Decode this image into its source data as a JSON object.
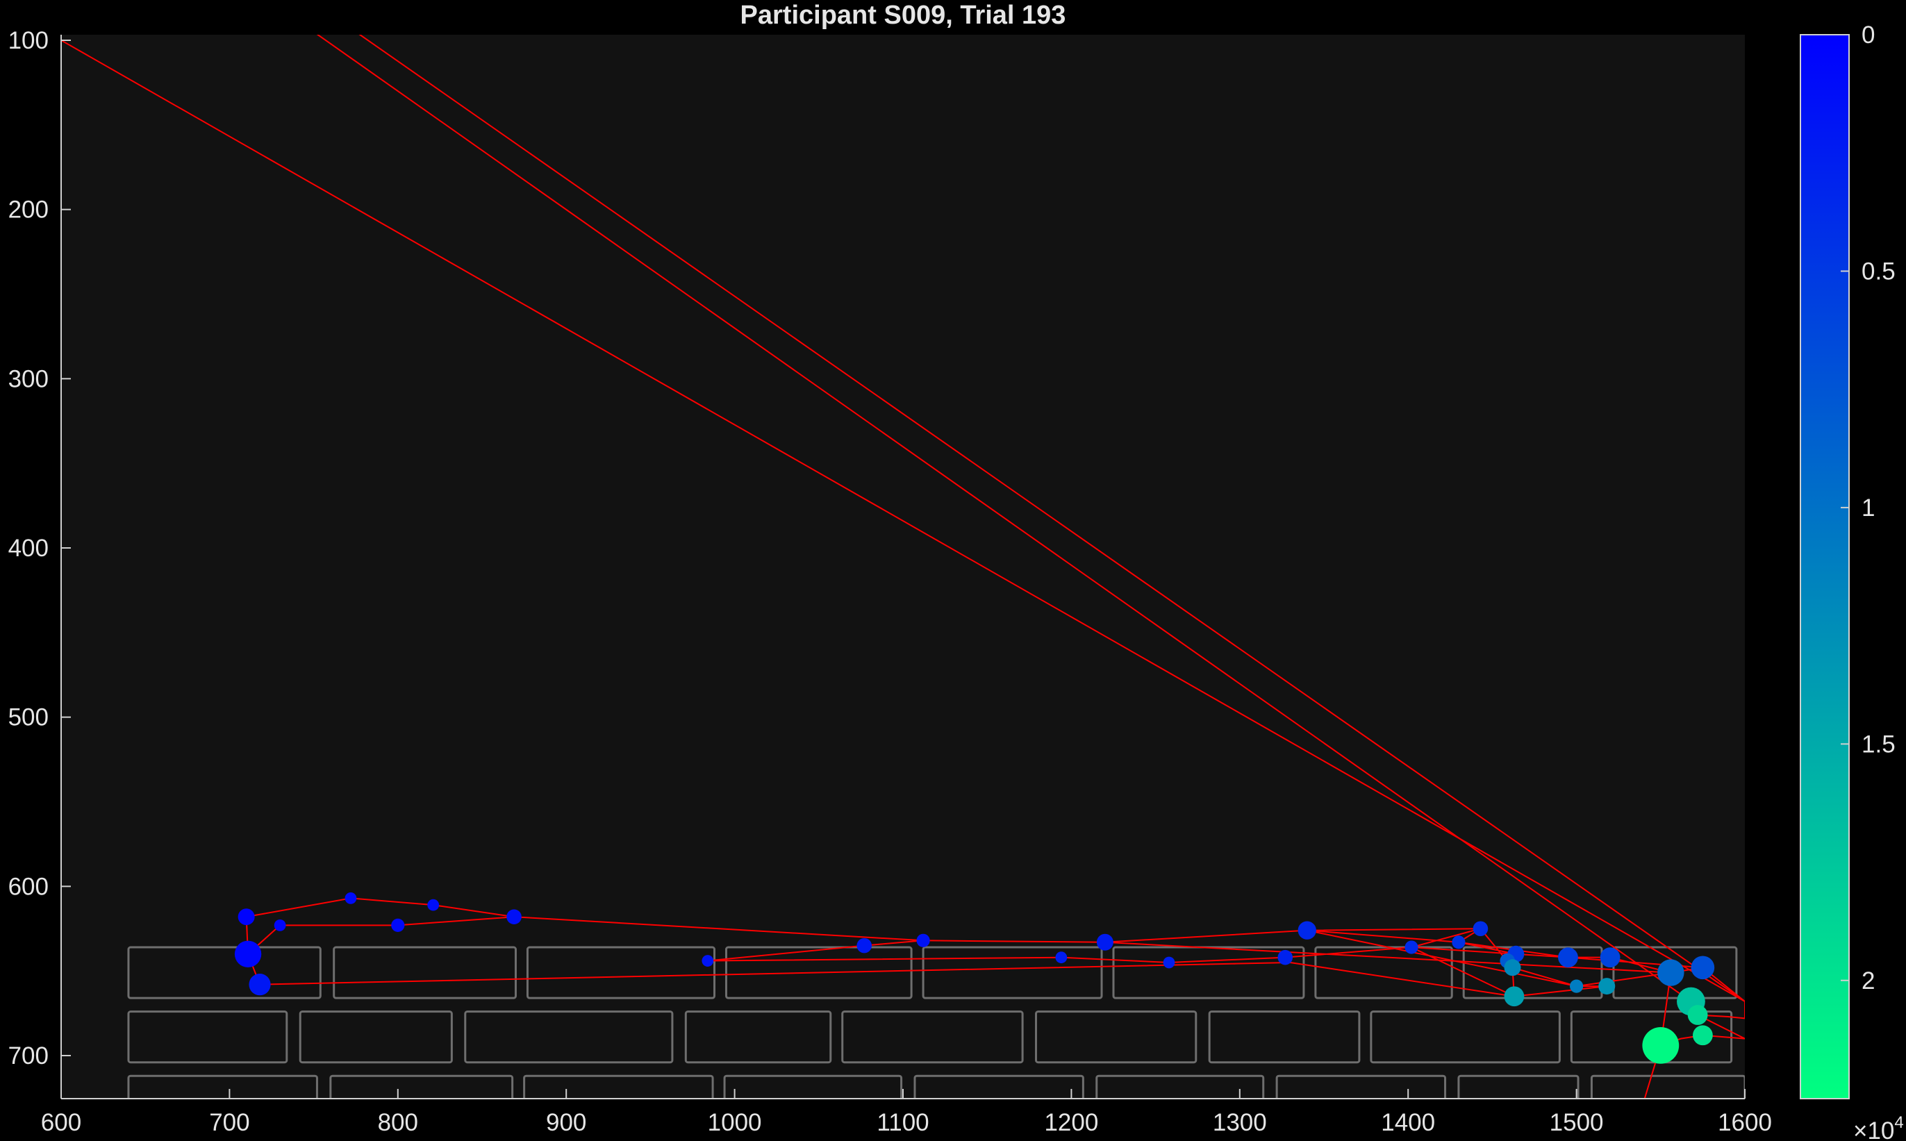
{
  "chart_data": {
    "type": "scatter",
    "title": "Participant S009, Trial 193",
    "xlabel": "",
    "ylabel": "",
    "xlim": [
      600,
      1600
    ],
    "ylim": [
      700,
      100
    ],
    "y_reversed": true,
    "xticks": [
      "600",
      "700",
      "800",
      "900",
      "1000",
      "1100",
      "1200",
      "1300",
      "1400",
      "1500",
      "1600"
    ],
    "yticks": [
      "100",
      "200",
      "300",
      "400",
      "500",
      "600",
      "700"
    ],
    "colorbar": {
      "range": [
        0,
        2.25
      ],
      "ticks": [
        "0",
        "0.5",
        "1",
        "1.5",
        "2"
      ],
      "exponent_label": "×10",
      "exponent": "4",
      "colors": [
        "#0000ff",
        "#00ff80"
      ]
    },
    "background_color": "#121212",
    "path_color": "#ff0000",
    "box_color": "#6e6e6e",
    "key_boxes": [
      {
        "x0": 640,
        "x1": 754,
        "y0": 636,
        "y1": 666
      },
      {
        "x0": 762,
        "x1": 870,
        "y0": 636,
        "y1": 666
      },
      {
        "x0": 877,
        "x1": 988,
        "y0": 636,
        "y1": 666
      },
      {
        "x0": 995,
        "x1": 1105,
        "y0": 636,
        "y1": 666
      },
      {
        "x0": 1112,
        "x1": 1218,
        "y0": 636,
        "y1": 666
      },
      {
        "x0": 1225,
        "x1": 1338,
        "y0": 636,
        "y1": 666
      },
      {
        "x0": 1345,
        "x1": 1426,
        "y0": 636,
        "y1": 666
      },
      {
        "x0": 1433,
        "x1": 1515,
        "y0": 636,
        "y1": 666
      },
      {
        "x0": 1522,
        "x1": 1595,
        "y0": 636,
        "y1": 666
      },
      {
        "x0": 1602,
        "x1": 1700,
        "y0": 636,
        "y1": 666
      },
      {
        "x0": 640,
        "x1": 734,
        "y0": 674,
        "y1": 704
      },
      {
        "x0": 742,
        "x1": 832,
        "y0": 674,
        "y1": 704
      },
      {
        "x0": 840,
        "x1": 963,
        "y0": 674,
        "y1": 704
      },
      {
        "x0": 971,
        "x1": 1057,
        "y0": 674,
        "y1": 704
      },
      {
        "x0": 1064,
        "x1": 1171,
        "y0": 674,
        "y1": 704
      },
      {
        "x0": 1179,
        "x1": 1274,
        "y0": 674,
        "y1": 704
      },
      {
        "x0": 1282,
        "x1": 1371,
        "y0": 674,
        "y1": 704
      },
      {
        "x0": 1378,
        "x1": 1490,
        "y0": 674,
        "y1": 704
      },
      {
        "x0": 1497,
        "x1": 1592,
        "y0": 674,
        "y1": 704
      },
      {
        "x0": 640,
        "x1": 752,
        "y0": 712,
        "y1": 742
      },
      {
        "x0": 760,
        "x1": 868,
        "y0": 712,
        "y1": 742
      },
      {
        "x0": 875,
        "x1": 987,
        "y0": 712,
        "y1": 742
      },
      {
        "x0": 994,
        "x1": 1099,
        "y0": 712,
        "y1": 742
      },
      {
        "x0": 1107,
        "x1": 1207,
        "y0": 712,
        "y1": 742
      },
      {
        "x0": 1215,
        "x1": 1314,
        "y0": 712,
        "y1": 742
      },
      {
        "x0": 1322,
        "x1": 1422,
        "y0": 712,
        "y1": 742
      },
      {
        "x0": 1430,
        "x1": 1501,
        "y0": 712,
        "y1": 742
      },
      {
        "x0": 1509,
        "x1": 1600,
        "y0": 712,
        "y1": 742
      }
    ],
    "points": [
      {
        "x": 710,
        "y": 618,
        "t": 300,
        "r": 10
      },
      {
        "x": 730,
        "y": 623,
        "t": 500,
        "r": 7
      },
      {
        "x": 800,
        "y": 623,
        "t": 800,
        "r": 8
      },
      {
        "x": 772,
        "y": 607,
        "t": 1000,
        "r": 7
      },
      {
        "x": 821,
        "y": 611,
        "t": 1200,
        "r": 7
      },
      {
        "x": 869,
        "y": 618,
        "t": 1400,
        "r": 9
      },
      {
        "x": 1112,
        "y": 632,
        "t": 1600,
        "r": 8
      },
      {
        "x": 1220,
        "y": 633,
        "t": 2400,
        "r": 10
      },
      {
        "x": 1077,
        "y": 635,
        "t": 2200,
        "r": 9
      },
      {
        "x": 1340,
        "y": 626,
        "t": 3500,
        "r": 11
      },
      {
        "x": 1443,
        "y": 625,
        "t": 4000,
        "r": 9
      },
      {
        "x": 1430,
        "y": 633,
        "t": 4300,
        "r": 8
      },
      {
        "x": 1402,
        "y": 636,
        "t": 3800,
        "r": 8
      },
      {
        "x": 1327,
        "y": 642,
        "t": 3000,
        "r": 9
      },
      {
        "x": 1258,
        "y": 645,
        "t": 2700,
        "r": 7
      },
      {
        "x": 1194,
        "y": 642,
        "t": 2500,
        "r": 7
      },
      {
        "x": 984,
        "y": 644,
        "t": 1800,
        "r": 7
      },
      {
        "x": 718,
        "y": 658,
        "t": 2000,
        "r": 13
      },
      {
        "x": 711,
        "y": 640,
        "t": 600,
        "r": 16
      },
      {
        "x": 1464,
        "y": 640,
        "t": 5000,
        "r": 10
      },
      {
        "x": 1495,
        "y": 642,
        "t": 5500,
        "r": 12
      },
      {
        "x": 1520,
        "y": 642,
        "t": 6000,
        "r": 12
      },
      {
        "x": 1459,
        "y": 644,
        "t": 8000,
        "r": 9
      },
      {
        "x": 1462,
        "y": 648,
        "t": 12000,
        "r": 10
      },
      {
        "x": 1463,
        "y": 665,
        "t": 14000,
        "r": 12
      },
      {
        "x": 1500,
        "y": 659,
        "t": 11000,
        "r": 8
      },
      {
        "x": 1518,
        "y": 659,
        "t": 13000,
        "r": 10
      },
      {
        "x": 1575,
        "y": 648,
        "t": 7000,
        "r": 14
      },
      {
        "x": 1556,
        "y": 651,
        "t": 9000,
        "r": 16
      },
      {
        "x": 1568,
        "y": 668,
        "t": 17000,
        "r": 17
      },
      {
        "x": 1572,
        "y": 676,
        "t": 19000,
        "r": 12
      },
      {
        "x": 1575,
        "y": 688,
        "t": 20000,
        "r": 12
      },
      {
        "x": 1550,
        "y": 694,
        "t": 22000,
        "r": 22
      }
    ],
    "path": [
      [
        600,
        100
      ],
      [
        1600,
        668
      ],
      [
        1600,
        678
      ],
      [
        1590,
        677
      ],
      [
        1572,
        676
      ],
      [
        1600,
        690
      ],
      [
        1575,
        688
      ],
      [
        1562,
        690
      ],
      [
        1550,
        694
      ],
      [
        1530,
        760
      ],
      [
        1550,
        694
      ],
      [
        1556,
        651
      ],
      [
        1575,
        648
      ],
      [
        1556,
        651
      ],
      [
        1520,
        642
      ],
      [
        1495,
        642
      ],
      [
        1464,
        640
      ],
      [
        1459,
        644
      ],
      [
        1462,
        648
      ],
      [
        1463,
        665
      ],
      [
        1518,
        659
      ],
      [
        1500,
        659
      ],
      [
        1462,
        648
      ],
      [
        1443,
        625
      ],
      [
        1340,
        626
      ],
      [
        1430,
        633
      ],
      [
        1464,
        640
      ],
      [
        1402,
        636
      ],
      [
        1327,
        642
      ],
      [
        1258,
        645
      ],
      [
        1194,
        642
      ],
      [
        984,
        644
      ],
      [
        1077,
        635
      ],
      [
        1112,
        632
      ],
      [
        1220,
        633
      ],
      [
        1340,
        626
      ],
      [
        1500,
        659
      ],
      [
        1556,
        651
      ],
      [
        1220,
        633
      ],
      [
        1112,
        632
      ],
      [
        869,
        618
      ],
      [
        821,
        611
      ],
      [
        772,
        607
      ],
      [
        710,
        618
      ],
      [
        711,
        640
      ],
      [
        730,
        623
      ],
      [
        800,
        623
      ],
      [
        869,
        618
      ],
      [
        800,
        623
      ],
      [
        730,
        623
      ],
      [
        711,
        640
      ],
      [
        718,
        658
      ],
      [
        1330,
        645
      ],
      [
        1463,
        665
      ],
      [
        1402,
        636
      ],
      [
        1443,
        625
      ],
      [
        1430,
        633
      ],
      [
        1495,
        642
      ],
      [
        1575,
        648
      ],
      [
        1600,
        668
      ]
    ],
    "long_lines": [
      {
        "x1": 750,
        "y1": 95,
        "x2": 1568,
        "y2": 668
      },
      {
        "x1": 775,
        "y1": 95,
        "x2": 1600,
        "y2": 668
      }
    ]
  }
}
